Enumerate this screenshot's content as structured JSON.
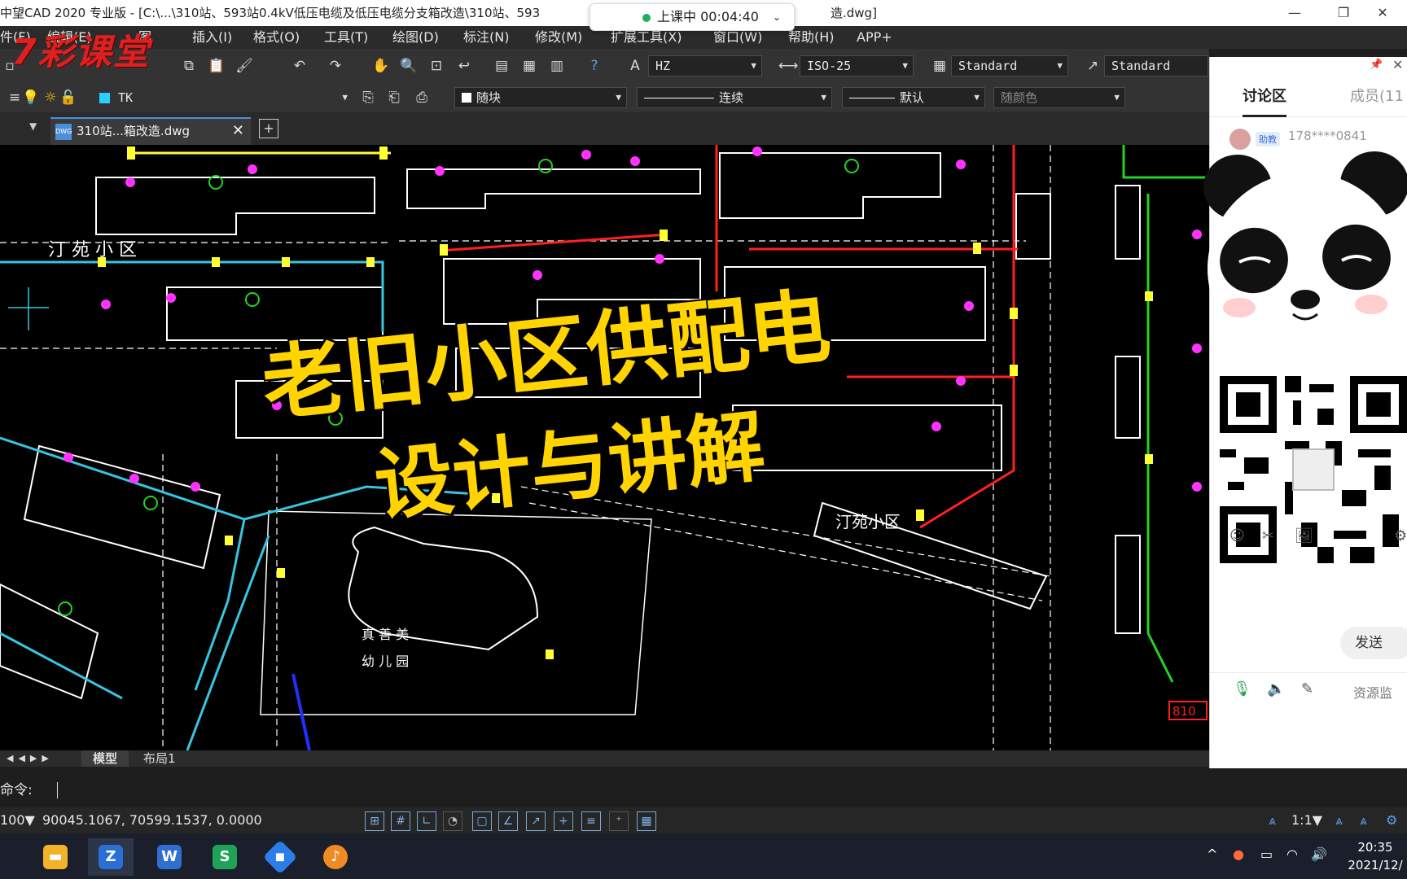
{
  "titlebar": {
    "title_left": "中望CAD 2020 专业版 - [C:\\...\\310站、593站0.4kV低压电缆及低压电缆分支箱改造\\310站、593",
    "title_right": "造.dwg]",
    "live_status": "上课中 00:04:40"
  },
  "watermark": "7彩课堂",
  "menu": [
    "件(F)",
    "编辑(E)",
    "图",
    "插入(I)",
    "格式(O)",
    "工具(T)",
    "绘图(D)",
    "标注(N)",
    "修改(M)",
    "扩展工具(X)",
    "窗口(W)",
    "帮助(H)",
    "APP+"
  ],
  "toolbar": {
    "text_style": "HZ",
    "dim_style": "ISO-25",
    "table_style": "Standard",
    "mleader_style": "Standard",
    "layer": "TK",
    "color": "随块",
    "linetype": "连续",
    "lineweight": "默认",
    "plotstyle": "随颜色"
  },
  "doc_tab": "310站...箱改造.dwg",
  "layout_tabs": [
    "模型",
    "布局1"
  ],
  "drawing": {
    "labels": {
      "area1": "汀  苑  小  区",
      "area2": "汀苑小区",
      "kindergarten_line1": "真  善  美",
      "kindergarten_line2": "幼  儿  园",
      "tag_810": "810"
    }
  },
  "overlay": {
    "line1": "老旧小区供配电",
    "line2": "设计与讲解"
  },
  "command": {
    "prompt": "命令:"
  },
  "status": {
    "scale_prefix": "100▼",
    "coords": "90045.1067, 70599.1537, 0.0000",
    "annotation_scale": "1:1▼"
  },
  "side_panel": {
    "tabs": [
      "讨论区",
      "成员(11"
    ],
    "badge": "助教",
    "user": "178****0841",
    "send_button": "发送",
    "footer_label": "资源监"
  },
  "taskbar": {
    "time": "20:35",
    "date": "2021/12/"
  },
  "colors": {
    "accent_blue": "#4a90d9",
    "cad_red": "#ff2020",
    "cad_cyan": "#36c6e0",
    "cad_green": "#21d421",
    "cad_yellow": "#ffff33",
    "cad_magenta": "#ff33ff",
    "overlay_yellow": "#ffd400"
  }
}
